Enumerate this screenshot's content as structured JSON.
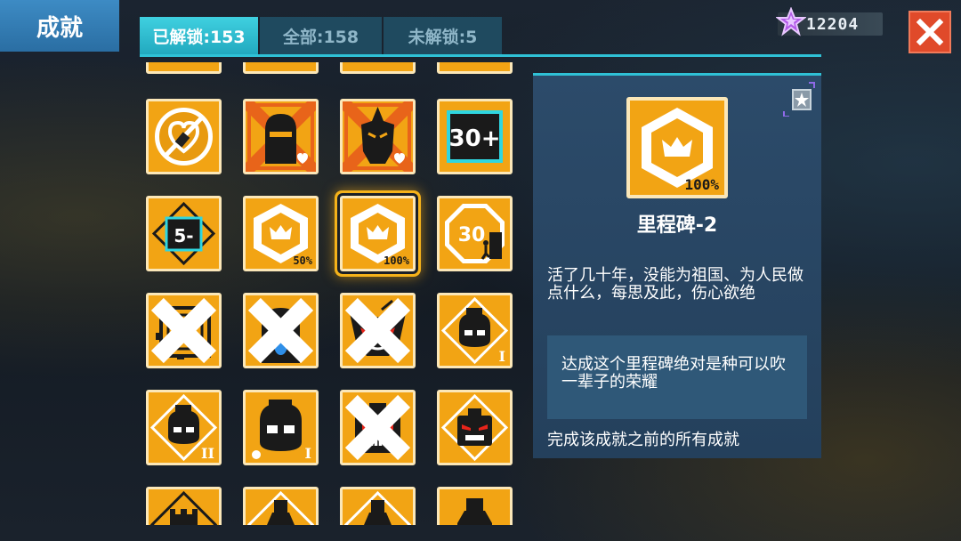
{
  "header": {
    "title": "成就",
    "tabs": [
      {
        "label": "已解锁:153",
        "active": true
      },
      {
        "label": "全部:158",
        "active": false
      },
      {
        "label": "未解锁:5",
        "active": false
      }
    ],
    "currency": {
      "icon": "purple-star-icon",
      "value": "12204"
    },
    "close_icon": "close-icon"
  },
  "achievements": [
    {
      "icon": "no-sword-heart-icon"
    },
    {
      "icon": "ninja-icon"
    },
    {
      "icon": "spartan-helmet-icon"
    },
    {
      "icon": "level-30-plus-icon"
    },
    {
      "icon": "level-5-minus-icon"
    },
    {
      "icon": "milestone-hexagon-icon",
      "progress": "50%"
    },
    {
      "icon": "milestone-hexagon-icon",
      "progress": "100%",
      "selected": true
    },
    {
      "icon": "stop-30-sign-icon"
    },
    {
      "icon": "eye-box-icon"
    },
    {
      "icon": "sad-ghost-icon"
    },
    {
      "icon": "demon-mask-icon"
    },
    {
      "icon": "goggles-head-icon",
      "rank": "I"
    },
    {
      "icon": "goggles-head-icon",
      "rank": "II"
    },
    {
      "icon": "goggles-head-icon",
      "rank": "I"
    },
    {
      "icon": "robot-boss-icon"
    },
    {
      "icon": "robot-boss-icon"
    },
    {
      "icon": "castle-icon"
    },
    {
      "icon": "bottle-icon"
    },
    {
      "icon": "bottle-icon"
    },
    {
      "icon": "bottle-icon"
    }
  ],
  "detail": {
    "icon": "milestone-hexagon-icon",
    "progress": "100%",
    "name": "里程碑-2",
    "description": "活了几十年，没能为祖国、为人民做点什么，每思及此，伤心欲绝",
    "quote": "达成这个里程碑绝对是种可以吹一辈子的荣耀",
    "condition": "完成该成就之前的所有成就"
  }
}
